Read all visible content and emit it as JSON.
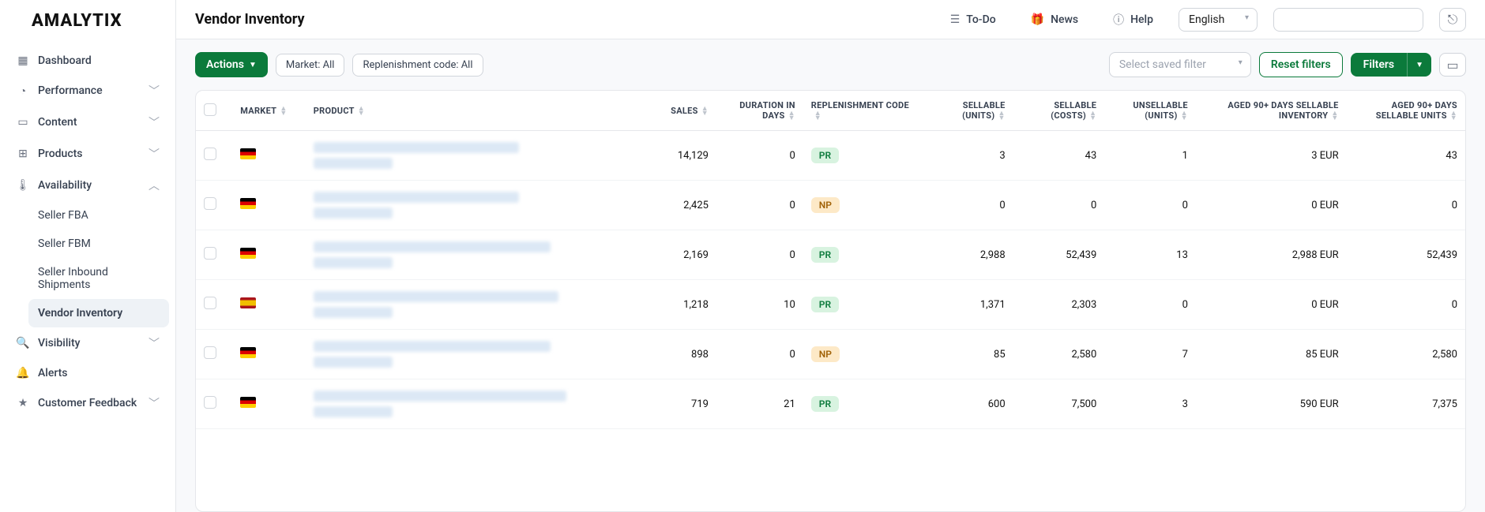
{
  "brand": "AMALYTIX",
  "page_title": "Vendor Inventory",
  "top_links": {
    "todo": "To-Do",
    "news": "News",
    "help": "Help"
  },
  "language": "English",
  "sidebar": {
    "items": [
      {
        "label": "Dashboard",
        "icon": "grid"
      },
      {
        "label": "Performance",
        "icon": "gauge",
        "expandable": true
      },
      {
        "label": "Content",
        "icon": "card",
        "expandable": true
      },
      {
        "label": "Products",
        "icon": "tag",
        "expandable": true
      },
      {
        "label": "Availability",
        "icon": "thermo",
        "expandable": true,
        "expanded": true,
        "children": [
          {
            "label": "Seller FBA"
          },
          {
            "label": "Seller FBM"
          },
          {
            "label": "Seller Inbound Shipments"
          },
          {
            "label": "Vendor Inventory",
            "active": true
          }
        ]
      },
      {
        "label": "Visibility",
        "icon": "search",
        "expandable": true
      },
      {
        "label": "Alerts",
        "icon": "bell"
      },
      {
        "label": "Customer Feedback",
        "icon": "star",
        "expandable": true
      }
    ]
  },
  "toolbar": {
    "actions_label": "Actions",
    "chip_market": "Market: All",
    "chip_code": "Replenishment code: All",
    "saved_filter_placeholder": "Select saved filter",
    "reset_label": "Reset filters",
    "filters_label": "Filters"
  },
  "columns": {
    "market": "MARKET",
    "product": "PRODUCT",
    "sales": "SALES",
    "duration": "DURATION IN DAYS",
    "code": "REPLENISHMENT CODE",
    "sell_units": "SELLABLE (UNITS)",
    "sell_costs": "SELLABLE (COSTS)",
    "unsell": "UNSELLABLE (UNITS)",
    "aged_inv": "AGED 90+ DAYS SELLABLE INVENTORY",
    "aged_units": "AGED 90+ DAYS SELLABLE UNITS"
  },
  "rows": [
    {
      "flag": "de",
      "sales": "14,129",
      "duration": "0",
      "code": "PR",
      "sell_units": "3",
      "sell_costs": "43",
      "unsell": "1",
      "aged_inv": "3 EUR",
      "aged_units": "43"
    },
    {
      "flag": "de",
      "sales": "2,425",
      "duration": "0",
      "code": "NP",
      "sell_units": "0",
      "sell_costs": "0",
      "unsell": "0",
      "aged_inv": "0 EUR",
      "aged_units": "0"
    },
    {
      "flag": "de",
      "sales": "2,169",
      "duration": "0",
      "code": "PR",
      "sell_units": "2,988",
      "sell_costs": "52,439",
      "unsell": "13",
      "aged_inv": "2,988 EUR",
      "aged_units": "52,439"
    },
    {
      "flag": "es",
      "sales": "1,218",
      "duration": "10",
      "code": "PR",
      "sell_units": "1,371",
      "sell_costs": "2,303",
      "unsell": "0",
      "aged_inv": "0 EUR",
      "aged_units": "0"
    },
    {
      "flag": "de",
      "sales": "898",
      "duration": "0",
      "code": "NP",
      "sell_units": "85",
      "sell_costs": "2,580",
      "unsell": "7",
      "aged_inv": "85 EUR",
      "aged_units": "2,580"
    },
    {
      "flag": "de",
      "sales": "719",
      "duration": "21",
      "code": "PR",
      "sell_units": "600",
      "sell_costs": "7,500",
      "unsell": "3",
      "aged_inv": "590 EUR",
      "aged_units": "7,375"
    }
  ]
}
